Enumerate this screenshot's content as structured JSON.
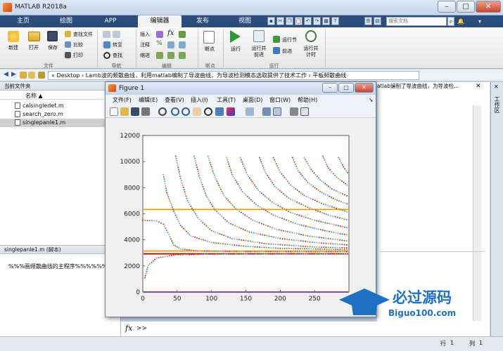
{
  "window": {
    "title": "MATLAB R2018a",
    "min": "–",
    "max": "□",
    "close": "✕"
  },
  "tabs": [
    {
      "label": "主页"
    },
    {
      "label": "绘图"
    },
    {
      "label": "APP"
    },
    {
      "label": "编辑器"
    },
    {
      "label": "发布"
    },
    {
      "label": "视图"
    }
  ],
  "search": {
    "placeholder": "搜索文档"
  },
  "ribbon": {
    "file": {
      "new": "新建",
      "open": "打开",
      "save": "保存",
      "find_files": "查找文件",
      "compare": "比较",
      "print": "打印",
      "group": "文件"
    },
    "nav": {
      "goto": "转至",
      "find": "查找",
      "group": "导航"
    },
    "edit": {
      "insert": "插入",
      "fx": "fx",
      "comment": "注释",
      "indent": "缩进",
      "group": "编辑"
    },
    "breakpoints": {
      "label": "断点",
      "group": "断点"
    },
    "run": {
      "run": "运行",
      "run_advance": "运行并\n前进",
      "run_section": "运行节",
      "advance": "前进",
      "run_time": "运行并\n计时",
      "group": "运行"
    }
  },
  "address": {
    "path": "« Desktop › Lamb波的频散曲线，利用matlab编制了导波曲线，为导波检测模态选取提供了技术工作 › 平板频散曲线",
    "right_text": "atlab编制了导波曲线，为导波检..."
  },
  "filebrowser": {
    "title": "当前文件夹",
    "col_name": "名称 ▲",
    "files": [
      "calsingledet.m",
      "search_zero.m",
      "singlepanle1.m"
    ]
  },
  "details": {
    "title": "singlepanle1.m  (脚本)",
    "desc": "%%%画频散曲线的主程序%%%%%%"
  },
  "cmd": {
    "fx": "fx",
    "prompt": ">>"
  },
  "status": {
    "row_label": "行",
    "row": "1",
    "col_label": "列",
    "col": "1"
  },
  "figure": {
    "title": "Figure 1",
    "menu": [
      "文件(F)",
      "编辑(E)",
      "查看(V)",
      "插入(I)",
      "工具(T)",
      "桌面(D)",
      "窗口(W)",
      "帮助(H)"
    ]
  },
  "chart_data": {
    "type": "scatter",
    "title": "",
    "xlabel": "",
    "ylabel": "",
    "xlim": [
      0,
      300
    ],
    "ylim": [
      0,
      12000
    ],
    "xticks": [
      0,
      50,
      100,
      150,
      200,
      250
    ],
    "yticks": [
      0,
      2000,
      4000,
      6000,
      8000,
      10000,
      12000
    ],
    "grid": false,
    "hlines": [
      {
        "y": 6330,
        "color": "#f0a000"
      },
      {
        "y": 3140,
        "color": "#f0a000"
      },
      {
        "y": 2930,
        "color": "#c00000"
      },
      {
        "y": 0,
        "color": "#7b2fa5"
      }
    ],
    "curves": [
      {
        "points": [
          [
            3,
            1100
          ],
          [
            8,
            2050
          ],
          [
            20,
            2600
          ],
          [
            45,
            2840
          ],
          [
            100,
            2905
          ],
          [
            200,
            2925
          ],
          [
            300,
            2930
          ]
        ]
      },
      {
        "points": [
          [
            0,
            5500
          ],
          [
            20,
            5450
          ],
          [
            30,
            5200
          ],
          [
            38,
            4400
          ],
          [
            45,
            3600
          ],
          [
            55,
            3300
          ],
          [
            80,
            3150
          ],
          [
            150,
            3100
          ],
          [
            300,
            3090
          ]
        ]
      },
      {
        "points": [
          [
            30,
            9000
          ],
          [
            35,
            7600
          ],
          [
            45,
            6200
          ],
          [
            55,
            5100
          ],
          [
            70,
            4300
          ],
          [
            100,
            3800
          ],
          [
            150,
            3500
          ],
          [
            200,
            3350
          ],
          [
            300,
            3250
          ]
        ]
      },
      {
        "points": [
          [
            48,
            10400
          ],
          [
            55,
            8700
          ],
          [
            65,
            7000
          ],
          [
            80,
            5700
          ],
          [
            100,
            4700
          ],
          [
            130,
            4100
          ],
          [
            180,
            3700
          ],
          [
            250,
            3450
          ],
          [
            300,
            3380
          ]
        ]
      },
      {
        "points": [
          [
            75,
            10400
          ],
          [
            82,
            8900
          ],
          [
            92,
            7400
          ],
          [
            105,
            6300
          ],
          [
            125,
            5300
          ],
          [
            155,
            4600
          ],
          [
            200,
            4100
          ],
          [
            250,
            3800
          ],
          [
            300,
            3600
          ]
        ]
      },
      {
        "points": [
          [
            95,
            10400
          ],
          [
            105,
            8800
          ],
          [
            118,
            7400
          ],
          [
            135,
            6400
          ],
          [
            160,
            5500
          ],
          [
            195,
            4800
          ],
          [
            240,
            4300
          ],
          [
            300,
            3900
          ]
        ]
      },
      {
        "points": [
          [
            122,
            10300
          ],
          [
            130,
            9000
          ],
          [
            145,
            7700
          ],
          [
            165,
            6700
          ],
          [
            190,
            5900
          ],
          [
            225,
            5200
          ],
          [
            265,
            4700
          ],
          [
            300,
            4350
          ]
        ]
      },
      {
        "points": [
          [
            142,
            10300
          ],
          [
            152,
            9000
          ],
          [
            168,
            7800
          ],
          [
            188,
            6900
          ],
          [
            215,
            6100
          ],
          [
            250,
            5500
          ],
          [
            300,
            4900
          ]
        ]
      },
      {
        "points": [
          [
            170,
            10300
          ],
          [
            178,
            9200
          ],
          [
            192,
            8100
          ],
          [
            212,
            7200
          ],
          [
            240,
            6500
          ],
          [
            270,
            5900
          ],
          [
            300,
            5500
          ]
        ]
      },
      {
        "points": [
          [
            190,
            10300
          ],
          [
            200,
            9200
          ],
          [
            215,
            8200
          ],
          [
            235,
            7400
          ],
          [
            260,
            6800
          ],
          [
            300,
            6100
          ]
        ]
      },
      {
        "points": [
          [
            218,
            10300
          ],
          [
            226,
            9300
          ],
          [
            240,
            8400
          ],
          [
            258,
            7700
          ],
          [
            280,
            7100
          ],
          [
            300,
            6700
          ]
        ]
      },
      {
        "points": [
          [
            235,
            10300
          ],
          [
            245,
            9400
          ],
          [
            258,
            8600
          ],
          [
            275,
            7900
          ],
          [
            300,
            7300
          ]
        ]
      },
      {
        "points": [
          [
            262,
            10400
          ],
          [
            270,
            9500
          ],
          [
            282,
            8800
          ],
          [
            300,
            8100
          ]
        ]
      },
      {
        "points": [
          [
            285,
            10300
          ],
          [
            292,
            9600
          ],
          [
            300,
            9000
          ]
        ]
      }
    ]
  }
}
